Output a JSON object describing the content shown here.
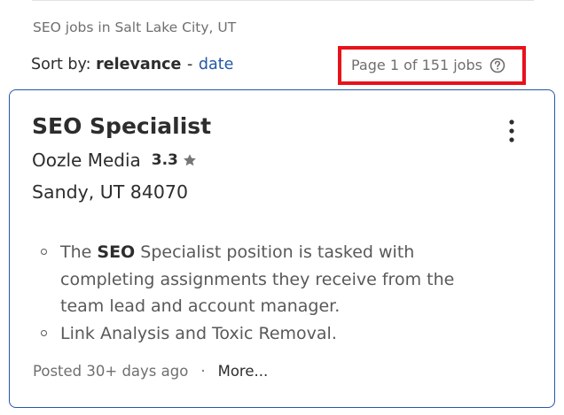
{
  "header": {
    "breadcrumb": "SEO jobs in Salt Lake City, UT",
    "sort_prefix": "Sort by:",
    "sort_active": "relevance",
    "sort_separator": "-",
    "sort_alt": "date",
    "page_count": "Page 1 of 151 jobs",
    "help_icon": "question-circle-icon"
  },
  "job": {
    "title": "SEO Specialist",
    "company": "Oozle Media",
    "rating": "3.3",
    "rating_icon": "star-icon",
    "location": "Sandy, UT 84070",
    "snippet": [
      {
        "before": "The ",
        "highlight": "SEO",
        "after": " Specialist position is tasked with completing assignments they receive from the team lead and account manager."
      },
      {
        "before": "Link Analysis and Toxic Removal.",
        "highlight": "",
        "after": ""
      }
    ],
    "posted": "Posted 30+ days ago",
    "dot": "·",
    "more": "More..."
  },
  "colors": {
    "link": "#2557a7",
    "highlight_box": "#e8121b",
    "card_border": "#2557a7"
  }
}
